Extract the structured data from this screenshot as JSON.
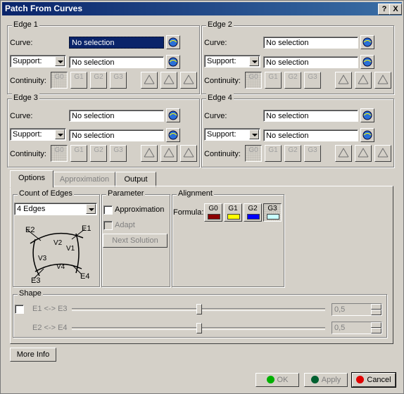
{
  "window": {
    "title": "Patch From Curves",
    "help_label": "?",
    "close_label": "X"
  },
  "edges": [
    {
      "title": "Edge 1",
      "curve_label": "Curve:",
      "curve_value": "No selection",
      "support_option": "Support:",
      "support_value": "No selection",
      "continuity_label": "Continuity:"
    },
    {
      "title": "Edge 2",
      "curve_label": "Curve:",
      "curve_value": "No selection",
      "support_option": "Support:",
      "support_value": "No selection",
      "continuity_label": "Continuity:"
    },
    {
      "title": "Edge 3",
      "curve_label": "Curve:",
      "curve_value": "No selection",
      "support_option": "Support:",
      "support_value": "No selection",
      "continuity_label": "Continuity:"
    },
    {
      "title": "Edge 4",
      "curve_label": "Curve:",
      "curve_value": "No selection",
      "support_option": "Support:",
      "support_value": "No selection",
      "continuity_label": "Continuity:"
    }
  ],
  "continuity_buttons": [
    "G0",
    "G1",
    "G2",
    "G3"
  ],
  "tabs": [
    {
      "label": "Options"
    },
    {
      "label": "Approximation"
    },
    {
      "label": "Output"
    }
  ],
  "count_of_edges": {
    "title": "Count of Edges",
    "selected": "4 Edges",
    "diagram": {
      "e1": "E1",
      "e2": "E2",
      "e3": "E3",
      "e4": "E4",
      "v1": "V1",
      "v2": "V2",
      "v3": "V3",
      "v4": "V4"
    }
  },
  "parameter": {
    "title": "Parameter",
    "approximation_label": "Approximation",
    "adapt_label": "Adapt",
    "next_solution_label": "Next Solution"
  },
  "alignment": {
    "title": "Alignment",
    "formula_label": "Formula:",
    "buttons": [
      {
        "label": "G0",
        "color": "#8b0000"
      },
      {
        "label": "G1",
        "color": "#ffff00"
      },
      {
        "label": "G2",
        "color": "#0000ff"
      },
      {
        "label": "G3",
        "color": "#c8ffff"
      }
    ]
  },
  "shape": {
    "title": "Shape",
    "row1_label": "E1 <-> E3",
    "row1_value": "0,5",
    "row2_label": "E2 <-> E4",
    "row2_value": "0,5"
  },
  "more_info_label": "More Info",
  "footer": {
    "ok_label": "OK",
    "apply_label": "Apply",
    "cancel_label": "Cancel",
    "ok_color": "#00b000",
    "apply_color": "#006030",
    "cancel_color": "#e00000"
  }
}
